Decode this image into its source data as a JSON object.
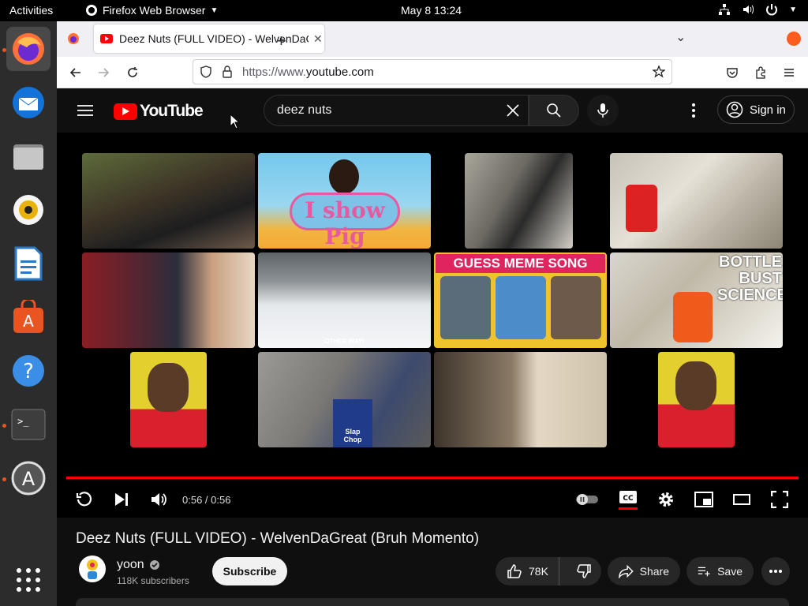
{
  "topbar": {
    "activities": "Activities",
    "app_name": "Firefox Web Browser",
    "clock": "May 8  13:24"
  },
  "dock": {
    "items": [
      "firefox",
      "thunderbird",
      "files",
      "rhythmbox",
      "writer",
      "app-center",
      "help",
      "terminal",
      "software-updater",
      "show-apps"
    ]
  },
  "browser": {
    "tab_title": "Deez Nuts (FULL VIDEO) - WelvenDaGreat (Bruh Momento)",
    "url_prefix": "https://www.",
    "url_domain": "youtube.com"
  },
  "youtube": {
    "logo_text": "YouTube",
    "search_value": "deez nuts",
    "signin_label": "Sign in"
  },
  "player": {
    "time": "0:56 / 0:56",
    "thumbnails": [
      {
        "caption": ""
      },
      {
        "caption": "I show Pig"
      },
      {
        "caption": ""
      },
      {
        "caption": ""
      },
      {
        "caption": ""
      },
      {
        "caption": "OTHER WAY!"
      },
      {
        "caption": "GUESS MEME SONG"
      },
      {
        "caption": "BOTTLE BUST SCIENCE"
      },
      {
        "caption": ""
      },
      {
        "caption": "Slap Chop"
      },
      {
        "caption": ""
      },
      {
        "caption": ""
      }
    ]
  },
  "video": {
    "title": "Deez Nuts (FULL VIDEO) - WelvenDaGreat (Bruh Momento)",
    "channel": "yoon",
    "subscribers": "118K subscribers",
    "subscribe_label": "Subscribe",
    "likes": "78K",
    "share_label": "Share",
    "save_label": "Save"
  },
  "colors": {
    "yt_red": "#ff0000",
    "page_bg": "#0f0f0f",
    "dock_bg": "#2c2c2c",
    "accent_orange": "#e95420"
  }
}
